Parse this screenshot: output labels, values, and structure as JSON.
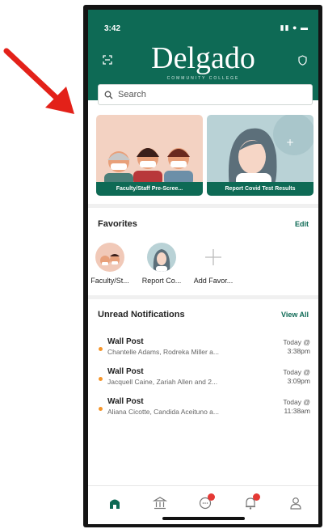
{
  "status": {
    "time": "3:42",
    "icons": "▮▮ ● ▬"
  },
  "header": {
    "logo": "Delgado",
    "logo_sub": "COMMUNITY COLLEGE"
  },
  "search": {
    "placeholder": "Search"
  },
  "cards": [
    {
      "label": "Faculty/Staff Pre-Scree..."
    },
    {
      "label": "Report Covid Test Results"
    }
  ],
  "favorites": {
    "title": "Favorites",
    "edit_label": "Edit",
    "items": [
      {
        "label": "Faculty/St..."
      },
      {
        "label": "Report Co..."
      },
      {
        "label": "Add Favor..."
      }
    ]
  },
  "notifications": {
    "title": "Unread Notifications",
    "view_all_label": "View All",
    "items": [
      {
        "heading": "Wall Post",
        "sub": "Chantelle Adams, Rodreka Miller a...",
        "time_line1": "Today @",
        "time_line2": "3:38pm"
      },
      {
        "heading": "Wall Post",
        "sub": "Jacquell Caine, Zariah Allen and  2...",
        "time_line1": "Today @",
        "time_line2": "3:09pm"
      },
      {
        "heading": "Wall Post",
        "sub": "Aliana Cicotte, Candida Aceituno a...",
        "time_line1": "Today @",
        "time_line2": "11:38am"
      }
    ]
  },
  "tabbar": {
    "icons": [
      "home-icon",
      "institution-icon",
      "chat-icon",
      "bell-icon",
      "profile-icon"
    ]
  },
  "colors": {
    "brand": "#0e6a55",
    "accent_dot": "#f5952a",
    "badge": "#e53935",
    "arrow": "#e32119"
  }
}
